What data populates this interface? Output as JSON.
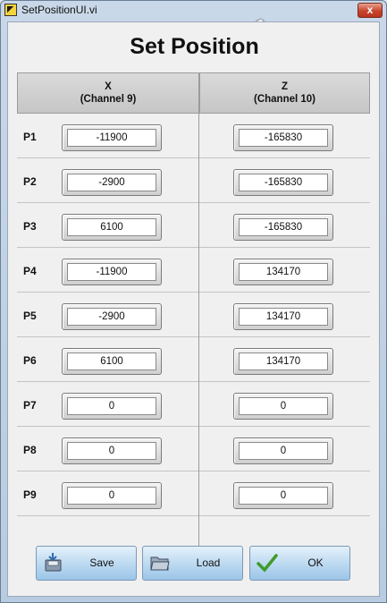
{
  "window": {
    "title": "SetPositionUI.vi",
    "close_symbol": "x"
  },
  "heading": "Set Position",
  "columns": {
    "x": {
      "name": "X",
      "channel": "(Channel 9)"
    },
    "z": {
      "name": "Z",
      "channel": "(Channel 10)"
    }
  },
  "rows": [
    {
      "label": "P1",
      "x": "-11900",
      "z": "-165830"
    },
    {
      "label": "P2",
      "x": "-2900",
      "z": "-165830"
    },
    {
      "label": "P3",
      "x": "6100",
      "z": "-165830"
    },
    {
      "label": "P4",
      "x": "-11900",
      "z": "134170"
    },
    {
      "label": "P5",
      "x": "-2900",
      "z": "134170"
    },
    {
      "label": "P6",
      "x": "6100",
      "z": "134170"
    },
    {
      "label": "P7",
      "x": "0",
      "z": "0"
    },
    {
      "label": "P8",
      "x": "0",
      "z": "0"
    },
    {
      "label": "P9",
      "x": "0",
      "z": "0"
    }
  ],
  "buttons": {
    "save": "Save",
    "load": "Load",
    "ok": "OK"
  },
  "icons": {
    "app": "labview-vi-icon",
    "save": "save-disk-icon",
    "load": "open-folder-icon",
    "ok": "checkmark-icon"
  }
}
